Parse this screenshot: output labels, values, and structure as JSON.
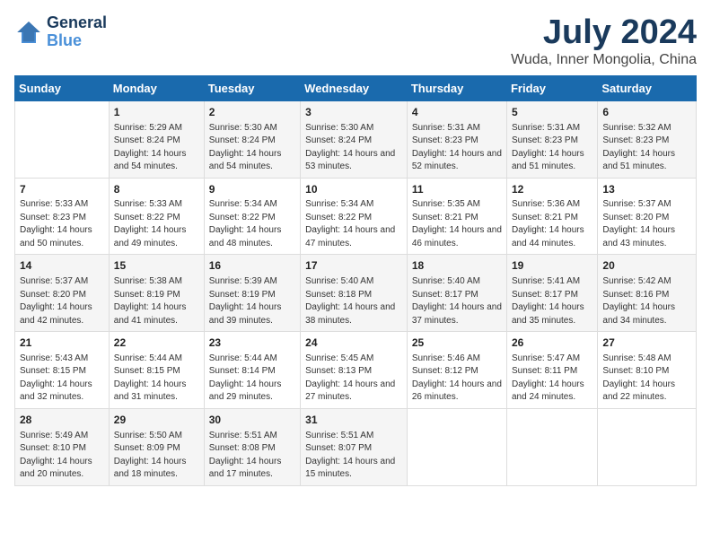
{
  "logo": {
    "line1": "General",
    "line2": "Blue"
  },
  "title": "July 2024",
  "subtitle": "Wuda, Inner Mongolia, China",
  "days_header": [
    "Sunday",
    "Monday",
    "Tuesday",
    "Wednesday",
    "Thursday",
    "Friday",
    "Saturday"
  ],
  "weeks": [
    [
      {
        "day": "",
        "sunrise": "",
        "sunset": "",
        "daylight": ""
      },
      {
        "day": "1",
        "sunrise": "Sunrise: 5:29 AM",
        "sunset": "Sunset: 8:24 PM",
        "daylight": "Daylight: 14 hours and 54 minutes."
      },
      {
        "day": "2",
        "sunrise": "Sunrise: 5:30 AM",
        "sunset": "Sunset: 8:24 PM",
        "daylight": "Daylight: 14 hours and 54 minutes."
      },
      {
        "day": "3",
        "sunrise": "Sunrise: 5:30 AM",
        "sunset": "Sunset: 8:24 PM",
        "daylight": "Daylight: 14 hours and 53 minutes."
      },
      {
        "day": "4",
        "sunrise": "Sunrise: 5:31 AM",
        "sunset": "Sunset: 8:23 PM",
        "daylight": "Daylight: 14 hours and 52 minutes."
      },
      {
        "day": "5",
        "sunrise": "Sunrise: 5:31 AM",
        "sunset": "Sunset: 8:23 PM",
        "daylight": "Daylight: 14 hours and 51 minutes."
      },
      {
        "day": "6",
        "sunrise": "Sunrise: 5:32 AM",
        "sunset": "Sunset: 8:23 PM",
        "daylight": "Daylight: 14 hours and 51 minutes."
      }
    ],
    [
      {
        "day": "7",
        "sunrise": "Sunrise: 5:33 AM",
        "sunset": "Sunset: 8:23 PM",
        "daylight": "Daylight: 14 hours and 50 minutes."
      },
      {
        "day": "8",
        "sunrise": "Sunrise: 5:33 AM",
        "sunset": "Sunset: 8:22 PM",
        "daylight": "Daylight: 14 hours and 49 minutes."
      },
      {
        "day": "9",
        "sunrise": "Sunrise: 5:34 AM",
        "sunset": "Sunset: 8:22 PM",
        "daylight": "Daylight: 14 hours and 48 minutes."
      },
      {
        "day": "10",
        "sunrise": "Sunrise: 5:34 AM",
        "sunset": "Sunset: 8:22 PM",
        "daylight": "Daylight: 14 hours and 47 minutes."
      },
      {
        "day": "11",
        "sunrise": "Sunrise: 5:35 AM",
        "sunset": "Sunset: 8:21 PM",
        "daylight": "Daylight: 14 hours and 46 minutes."
      },
      {
        "day": "12",
        "sunrise": "Sunrise: 5:36 AM",
        "sunset": "Sunset: 8:21 PM",
        "daylight": "Daylight: 14 hours and 44 minutes."
      },
      {
        "day": "13",
        "sunrise": "Sunrise: 5:37 AM",
        "sunset": "Sunset: 8:20 PM",
        "daylight": "Daylight: 14 hours and 43 minutes."
      }
    ],
    [
      {
        "day": "14",
        "sunrise": "Sunrise: 5:37 AM",
        "sunset": "Sunset: 8:20 PM",
        "daylight": "Daylight: 14 hours and 42 minutes."
      },
      {
        "day": "15",
        "sunrise": "Sunrise: 5:38 AM",
        "sunset": "Sunset: 8:19 PM",
        "daylight": "Daylight: 14 hours and 41 minutes."
      },
      {
        "day": "16",
        "sunrise": "Sunrise: 5:39 AM",
        "sunset": "Sunset: 8:19 PM",
        "daylight": "Daylight: 14 hours and 39 minutes."
      },
      {
        "day": "17",
        "sunrise": "Sunrise: 5:40 AM",
        "sunset": "Sunset: 8:18 PM",
        "daylight": "Daylight: 14 hours and 38 minutes."
      },
      {
        "day": "18",
        "sunrise": "Sunrise: 5:40 AM",
        "sunset": "Sunset: 8:17 PM",
        "daylight": "Daylight: 14 hours and 37 minutes."
      },
      {
        "day": "19",
        "sunrise": "Sunrise: 5:41 AM",
        "sunset": "Sunset: 8:17 PM",
        "daylight": "Daylight: 14 hours and 35 minutes."
      },
      {
        "day": "20",
        "sunrise": "Sunrise: 5:42 AM",
        "sunset": "Sunset: 8:16 PM",
        "daylight": "Daylight: 14 hours and 34 minutes."
      }
    ],
    [
      {
        "day": "21",
        "sunrise": "Sunrise: 5:43 AM",
        "sunset": "Sunset: 8:15 PM",
        "daylight": "Daylight: 14 hours and 32 minutes."
      },
      {
        "day": "22",
        "sunrise": "Sunrise: 5:44 AM",
        "sunset": "Sunset: 8:15 PM",
        "daylight": "Daylight: 14 hours and 31 minutes."
      },
      {
        "day": "23",
        "sunrise": "Sunrise: 5:44 AM",
        "sunset": "Sunset: 8:14 PM",
        "daylight": "Daylight: 14 hours and 29 minutes."
      },
      {
        "day": "24",
        "sunrise": "Sunrise: 5:45 AM",
        "sunset": "Sunset: 8:13 PM",
        "daylight": "Daylight: 14 hours and 27 minutes."
      },
      {
        "day": "25",
        "sunrise": "Sunrise: 5:46 AM",
        "sunset": "Sunset: 8:12 PM",
        "daylight": "Daylight: 14 hours and 26 minutes."
      },
      {
        "day": "26",
        "sunrise": "Sunrise: 5:47 AM",
        "sunset": "Sunset: 8:11 PM",
        "daylight": "Daylight: 14 hours and 24 minutes."
      },
      {
        "day": "27",
        "sunrise": "Sunrise: 5:48 AM",
        "sunset": "Sunset: 8:10 PM",
        "daylight": "Daylight: 14 hours and 22 minutes."
      }
    ],
    [
      {
        "day": "28",
        "sunrise": "Sunrise: 5:49 AM",
        "sunset": "Sunset: 8:10 PM",
        "daylight": "Daylight: 14 hours and 20 minutes."
      },
      {
        "day": "29",
        "sunrise": "Sunrise: 5:50 AM",
        "sunset": "Sunset: 8:09 PM",
        "daylight": "Daylight: 14 hours and 18 minutes."
      },
      {
        "day": "30",
        "sunrise": "Sunrise: 5:51 AM",
        "sunset": "Sunset: 8:08 PM",
        "daylight": "Daylight: 14 hours and 17 minutes."
      },
      {
        "day": "31",
        "sunrise": "Sunrise: 5:51 AM",
        "sunset": "Sunset: 8:07 PM",
        "daylight": "Daylight: 14 hours and 15 minutes."
      },
      {
        "day": "",
        "sunrise": "",
        "sunset": "",
        "daylight": ""
      },
      {
        "day": "",
        "sunrise": "",
        "sunset": "",
        "daylight": ""
      },
      {
        "day": "",
        "sunrise": "",
        "sunset": "",
        "daylight": ""
      }
    ]
  ]
}
